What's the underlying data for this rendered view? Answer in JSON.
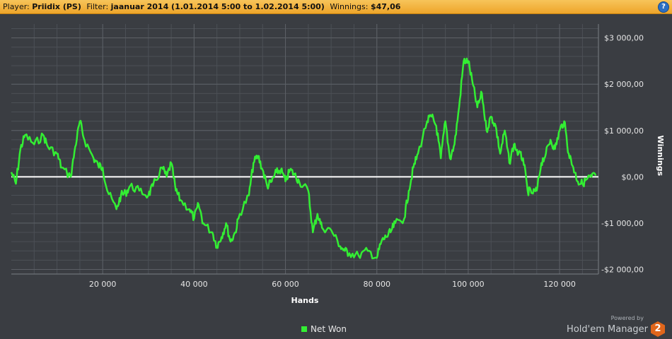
{
  "header": {
    "player_label": "Player:",
    "player_value": "Priidix (PS)",
    "filter_label": "Filter:",
    "filter_value": "jaanuar 2014 (1.01.2014 5:00 to 1.02.2014 5:00)",
    "winnings_label": "Winnings:",
    "winnings_value": "$47,06",
    "help_icon": "?"
  },
  "legend": {
    "label": "Net Won"
  },
  "brand": {
    "powered_by": "Powered by",
    "name": "Hold'em Manager",
    "logo_text": "2"
  },
  "colors": {
    "background": "#3a3d42",
    "line": "#33ee33",
    "zero_line": "#ffffff",
    "titlebar": "#f0ad33"
  },
  "chart_data": {
    "type": "line",
    "xlabel": "Hands",
    "ylabel": "Winnings",
    "xlim": [
      0,
      128500
    ],
    "ylim": [
      -2100,
      3300
    ],
    "x_ticks": [
      20000,
      40000,
      60000,
      80000,
      100000,
      120000
    ],
    "x_tick_labels": [
      "20 000",
      "40 000",
      "60 000",
      "80 000",
      "100 000",
      "120 000"
    ],
    "y_ticks": [
      -2000,
      -1000,
      0,
      1000,
      2000,
      3000
    ],
    "y_tick_labels": [
      "-$2 000,00",
      "-$1 000,00",
      "$0,00",
      "$1 000,00",
      "$2 000,00",
      "$3 000,00"
    ],
    "grid": true,
    "legend_position": "bottom-center",
    "series": [
      {
        "name": "Net Won",
        "x": [
          0,
          1000,
          2000,
          3000,
          5000,
          7000,
          8000,
          10000,
          11000,
          13000,
          14000,
          15000,
          16000,
          18000,
          19000,
          20000,
          21000,
          23000,
          24000,
          25000,
          26000,
          28000,
          30000,
          31000,
          33000,
          34000,
          35000,
          36000,
          37000,
          39000,
          40000,
          41000,
          42000,
          44000,
          45000,
          46000,
          47000,
          48000,
          49000,
          50000,
          52000,
          53000,
          54000,
          55000,
          56000,
          57000,
          58000,
          59000,
          60000,
          61000,
          62000,
          63000,
          65000,
          66000,
          67000,
          68000,
          70000,
          72000,
          73000,
          74000,
          76000,
          78000,
          80000,
          81000,
          82000,
          83000,
          84000,
          86000,
          87000,
          88000,
          89000,
          91000,
          92000,
          93000,
          94000,
          95000,
          96000,
          97000,
          98000,
          99000,
          100000,
          101000,
          102000,
          103000,
          104000,
          105000,
          106000,
          107000,
          108000,
          109000,
          110000,
          111000,
          112000,
          113000,
          114000,
          115000,
          116000,
          117000,
          118000,
          119000,
          120000,
          121000,
          122000,
          123000,
          124000,
          125000,
          126000,
          127000,
          128000
        ],
        "y": [
          100,
          -150,
          600,
          900,
          700,
          900,
          650,
          500,
          200,
          0,
          650,
          1200,
          800,
          400,
          250,
          200,
          -300,
          -700,
          -400,
          -350,
          -200,
          -300,
          -400,
          -200,
          200,
          0,
          300,
          -300,
          -500,
          -700,
          -900,
          -600,
          -1000,
          -1200,
          -1500,
          -1300,
          -1000,
          -1400,
          -1200,
          -800,
          -400,
          300,
          450,
          150,
          -200,
          -100,
          100,
          150,
          -100,
          150,
          50,
          -100,
          -300,
          -1200,
          -800,
          -1100,
          -1150,
          -1500,
          -1600,
          -1650,
          -1700,
          -1600,
          -1750,
          -1400,
          -1300,
          -1200,
          -1000,
          -900,
          -300,
          200,
          500,
          1200,
          1300,
          1100,
          400,
          1200,
          400,
          700,
          1500,
          2500,
          2500,
          2000,
          1500,
          1800,
          1000,
          1300,
          1100,
          500,
          1000,
          300,
          700,
          500,
          400,
          -300,
          -350,
          -300,
          300,
          500,
          800,
          600,
          1000,
          1200,
          500,
          200,
          -100,
          -150,
          -50,
          0,
          50
        ]
      }
    ]
  }
}
